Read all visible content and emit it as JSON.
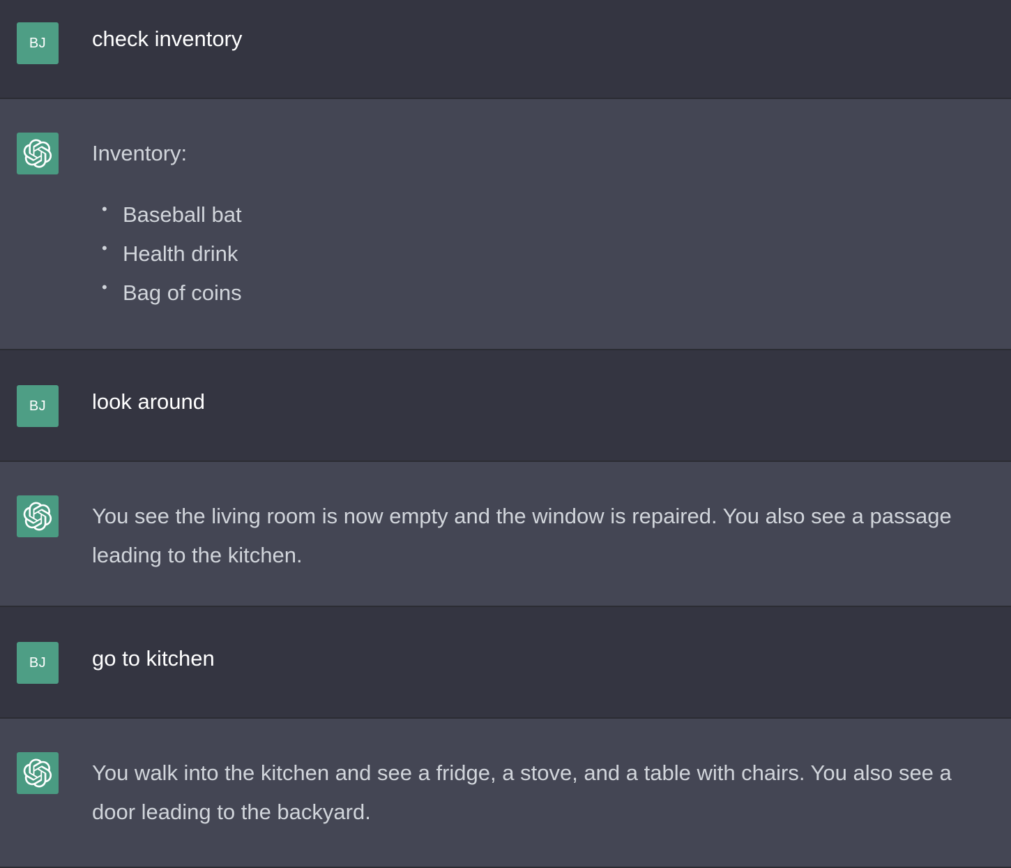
{
  "user": {
    "avatar_initials": "BJ"
  },
  "assistant": {
    "avatar_icon": "openai-logo-icon"
  },
  "colors": {
    "user_bg": "#343541",
    "assistant_bg": "#444654",
    "avatar_bg": "#4e9e85",
    "user_text": "#ffffff",
    "assistant_text": "#d1d5db"
  },
  "messages": [
    {
      "role": "user",
      "text": "check inventory"
    },
    {
      "role": "assistant",
      "heading": "Inventory:",
      "items": [
        "Baseball bat",
        "Health drink",
        "Bag of coins"
      ]
    },
    {
      "role": "user",
      "text": "look around"
    },
    {
      "role": "assistant",
      "text": "You see the living room is now empty and the window is repaired. You also see a passage leading to the kitchen."
    },
    {
      "role": "user",
      "text": "go to kitchen"
    },
    {
      "role": "assistant",
      "text": "You walk into the kitchen and see a fridge, a stove, and a table with chairs. You also see a door leading to the backyard."
    }
  ]
}
